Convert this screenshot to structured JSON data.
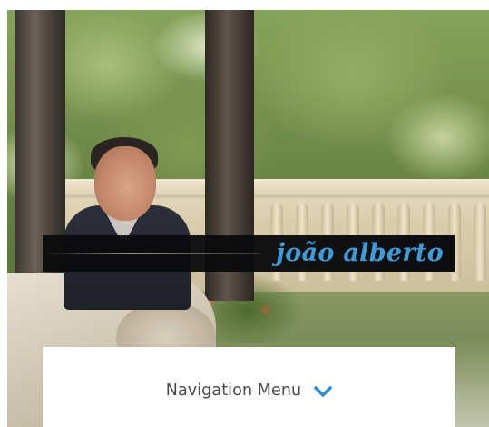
{
  "hero": {
    "banner_name": "joão alberto"
  },
  "navigation": {
    "toggle_label": "Navigation Menu",
    "toggle_icon": "chevron-down-icon"
  },
  "colors": {
    "banner_background": "#0d0d10",
    "banner_text": "#3d9bd9",
    "chevron": "#2f8fd6",
    "nav_text": "#4a4a4a",
    "page_background": "#ffffff"
  }
}
